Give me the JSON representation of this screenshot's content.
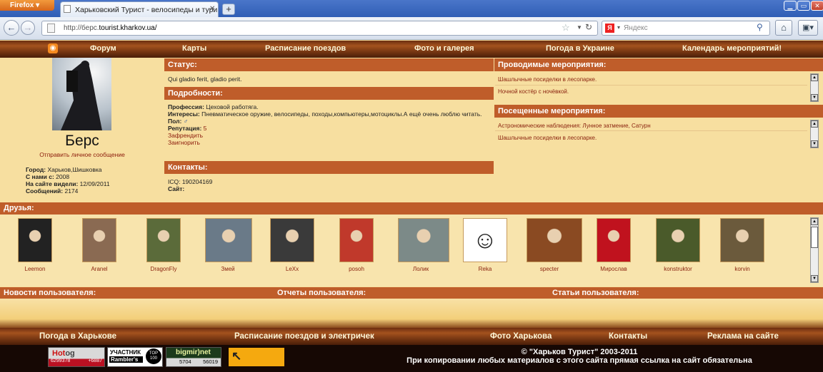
{
  "browser": {
    "app_name": "Firefox",
    "tab_title": "Харьковский Турист - велосипеды и тури...",
    "url_prefix": "http://берс.",
    "url_host": "tourist.kharkov.ua/",
    "search_placeholder": "Яндекс",
    "new_tab_glyph": "+",
    "close_glyph": "✕"
  },
  "top_nav": [
    "Форум",
    "Карты",
    "Расписание поездов",
    "Фото и галерея",
    "Погода в Украине",
    "Календарь мероприятий!"
  ],
  "profile": {
    "name": "Берс",
    "message_link": "Отправить личное сообщение",
    "fields": [
      {
        "label": "Город:",
        "value": "Харьков,Шишковка"
      },
      {
        "label": "С нами с:",
        "value": "2008"
      },
      {
        "label": "На сайте видели:",
        "value": "12/09/2011"
      },
      {
        "label": "Сообщений:",
        "value": "2174"
      }
    ]
  },
  "status": {
    "header": "Статус:",
    "text": "Qui gladio ferit, gladio perit."
  },
  "details": {
    "header": "Подробности:",
    "profession_label": "Профессия:",
    "profession": "Цеховой работяга.",
    "interests_label": "Интересы:",
    "interests": "Пневматическое оружие, велосипеды, походы,компьютеры,мотоциклы.А ещё очень люблю читать.",
    "gender_label": "Пол:",
    "gender": "♂",
    "reputation_label": "Репутация:",
    "reputation": "5",
    "friend_link": "Зафрендить",
    "ignore_link": "Заигнорить"
  },
  "contacts": {
    "header": "Контакты:",
    "icq": "ICQ: 190204169",
    "site_label": "Сайт:"
  },
  "events_held": {
    "header": "Проводимые мероприятия:",
    "items": [
      "Шашлычные посиделки в лесопарке.",
      "Ночной костёр с ночёвкой."
    ]
  },
  "events_visited": {
    "header": "Посещенные мероприятия:",
    "items": [
      "Астрономические наблюдения: Лунное затмение, Сатурн",
      "Шашлычные посиделки в лесопарке."
    ]
  },
  "friends": {
    "header": "Друзья:",
    "list": [
      {
        "name": "Leemon",
        "color": "#222222"
      },
      {
        "name": "Aranel",
        "color": "#8a6a52"
      },
      {
        "name": "DragonFly",
        "color": "#5b6b3a"
      },
      {
        "name": "Змей",
        "color": "#6a7a88"
      },
      {
        "name": "LeXx",
        "color": "#3a3a3a"
      },
      {
        "name": "posoh",
        "color": "#c0392b"
      },
      {
        "name": "Лолик",
        "color": "#7c8a88"
      },
      {
        "name": "Reka",
        "color": "#f4d63c"
      },
      {
        "name": "specter",
        "color": "#8a4a22"
      },
      {
        "name": "Мирослав",
        "color": "#c0121e"
      },
      {
        "name": "konstruktor",
        "color": "#4a5a2a"
      },
      {
        "name": "korvin",
        "color": "#6b5a3c"
      }
    ]
  },
  "user_sections": [
    "Новости пользователя:",
    "Отчеты пользователя:",
    "Статьи пользователя:"
  ],
  "bottom_nav": [
    "Погода в Харькове",
    "Расписание поездов и электричек",
    "Фото Харькова",
    "Контакты",
    "Реклама на сайте"
  ],
  "footer": {
    "copyright": "© \"Харьков Турист\" 2003-2011",
    "notice": "При копировании любых материалов с этого сайта прямая ссылка на сайт обязательна"
  },
  "counters": {
    "hotlog_label": "Hot",
    "hotlog_label2": "og",
    "hotlog_a": "6299378",
    "hotlog_b": "+6887",
    "rambler_label": "УЧАСТНИК",
    "rambler_sub": "Rambler's",
    "rambler_top": "TOP",
    "rambler_100": "100",
    "bigmir_label": "bigmir)net",
    "bigmir_a": "5704",
    "bigmir_b": "56019"
  }
}
